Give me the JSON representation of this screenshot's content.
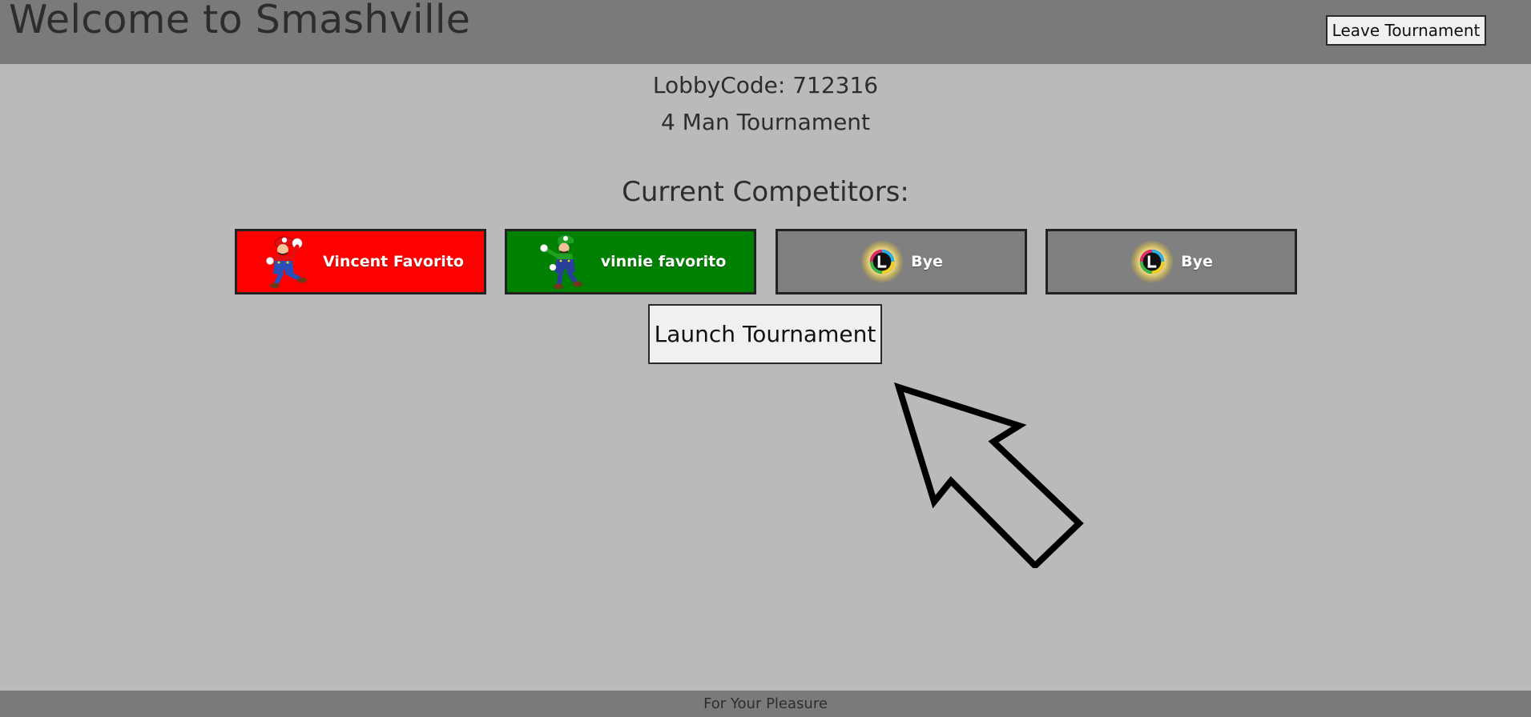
{
  "header": {
    "title": "Welcome to Smashville",
    "leave_label": "Leave Tournament"
  },
  "lobby": {
    "code_text": "LobbyCode: 712316",
    "type_text": "4 Man Tournament"
  },
  "competitors": {
    "heading": "Current Competitors:",
    "items": [
      {
        "name": "Vincent Favorito",
        "character": "mario",
        "color": "#ff0000"
      },
      {
        "name": "vinnie favorito",
        "character": "luigi",
        "color": "#008000"
      },
      {
        "name": "Bye",
        "character": "smash-ball",
        "color": "#808080"
      },
      {
        "name": "Bye",
        "character": "smash-ball",
        "color": "#808080"
      }
    ]
  },
  "launch_label": "Launch Tournament",
  "footer": {
    "text": "For Your Pleasure"
  }
}
